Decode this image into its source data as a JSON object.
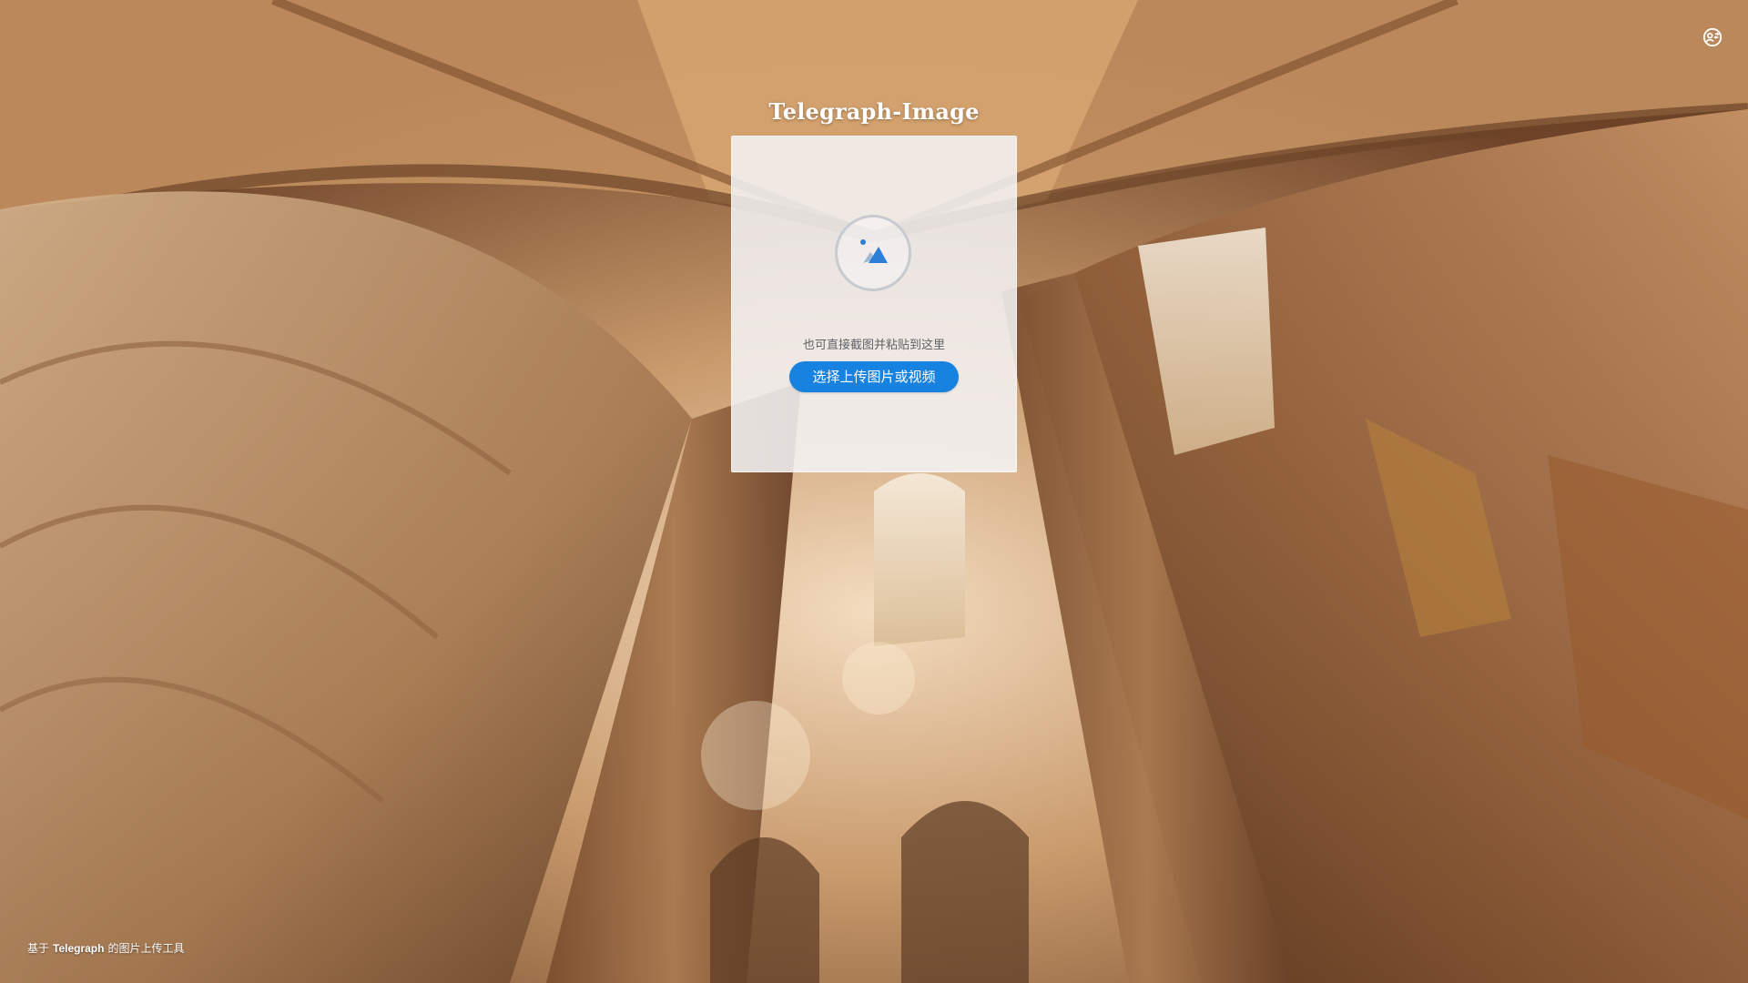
{
  "header": {
    "title": "Telegraph-Image",
    "account_icon": "account-switch-icon"
  },
  "upload": {
    "icon": "image-upload-icon",
    "paste_hint": "也可直接截图并粘贴到这里",
    "button_label": "选择上传图片或视频"
  },
  "footer": {
    "prefix": "基于",
    "brand": "Telegraph",
    "suffix": "的图片上传工具"
  },
  "colors": {
    "accent": "#1882e0",
    "card_bg": "#f5f5f7",
    "title_text": "#ffffff"
  }
}
